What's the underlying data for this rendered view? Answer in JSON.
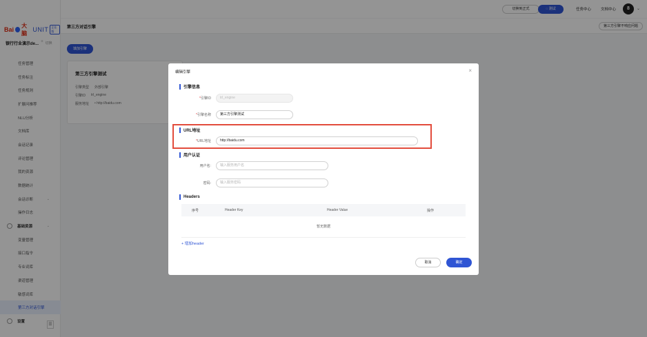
{
  "topbar": {
    "switch_formal": "切换到正式",
    "test": "测试",
    "task_center": "任务中心",
    "doc_center": "文档中心",
    "avatar": "8"
  },
  "sidebar": {
    "logo_bai": "Bai",
    "logo_dana": "大脑",
    "logo_unit": "UNIT",
    "logo_edition": "企业版",
    "bot_name": "银行行业演示de...",
    "bot_sup": "③",
    "bot_switch": "切换",
    "items": [
      {
        "label": "任务管理"
      },
      {
        "label": "任务标注"
      },
      {
        "label": "任务规则"
      },
      {
        "label": "扩展问推荐"
      },
      {
        "label": "NLU分析"
      },
      {
        "label": "文档库"
      },
      {
        "label": "会话记录"
      },
      {
        "label": "评论管理"
      },
      {
        "label": "我的资源"
      },
      {
        "label": "数据统计"
      },
      {
        "label": "会话诊断"
      },
      {
        "label": "操作日志"
      },
      {
        "label": "基础资源"
      },
      {
        "label": "变量管理"
      },
      {
        "label": "接口指令"
      },
      {
        "label": "专业词库"
      },
      {
        "label": "渠道管理"
      },
      {
        "label": "敏感词库"
      },
      {
        "label": "第三方对话引擎"
      },
      {
        "label": "设置"
      }
    ]
  },
  "page": {
    "title": "第三方对话引擎",
    "help": "第三方引擎不响应问题",
    "add_engine": "填加引擎"
  },
  "card": {
    "title": "第三方引擎测试",
    "rows": [
      {
        "label": "引擎类型",
        "value": "外部引擎"
      },
      {
        "label": "引擎ID",
        "value": "trl_engine"
      },
      {
        "label": "服务地址",
        "value": "• http://baidu.com"
      }
    ]
  },
  "modal": {
    "title": "编辑引擎",
    "close": "×",
    "sec_engine": "引擎信息",
    "engine_id_label": "引擎ID",
    "engine_id_value": "trl_engine",
    "engine_name_label": "引擎名称",
    "engine_name_value": "第三方引擎测试",
    "sec_url": "URL地址",
    "url_label": "URL地址",
    "url_value": "http://baidu.com",
    "sec_auth": "用户认证",
    "username_label": "用户名:",
    "username_placeholder": "输入服务用户名",
    "password_label": "密码:",
    "password_placeholder": "输入服务密码",
    "sec_headers": "Headers",
    "table_headers": [
      "序号",
      "Header Key",
      "Header Value",
      "操作"
    ],
    "table_empty": "暂无数据",
    "add_header": "+ 增加header",
    "cancel": "取消",
    "ok": "确定",
    "required_mark": "*"
  }
}
